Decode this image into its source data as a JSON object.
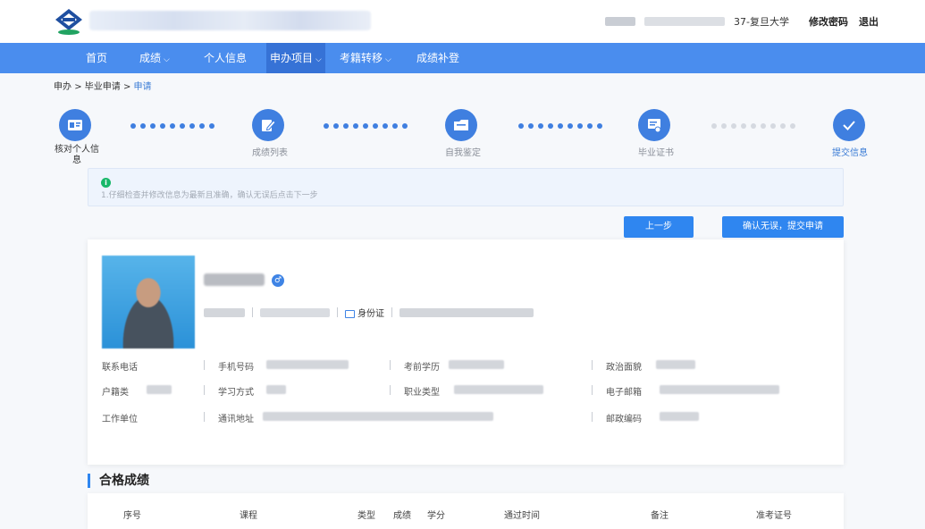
{
  "header": {
    "school_suffix": "37-复旦大学",
    "change_password": "修改密码",
    "logout": "退出"
  },
  "nav": {
    "items": [
      {
        "label": "首页",
        "dropdown": false
      },
      {
        "label": "成绩",
        "dropdown": true
      },
      {
        "label": "个人信息",
        "dropdown": false
      },
      {
        "label": "申办项目",
        "dropdown": true,
        "active": true
      },
      {
        "label": "考籍转移",
        "dropdown": true
      },
      {
        "label": "成绩补登",
        "dropdown": false
      }
    ]
  },
  "breadcrumb": {
    "part1": "申办",
    "part2": "毕业申请",
    "current": "申请",
    "separator": ">"
  },
  "steps": [
    {
      "label": "核对个人信息",
      "icon": "id-card-icon"
    },
    {
      "label": "成绩列表",
      "icon": "edit-icon"
    },
    {
      "label": "自我鉴定",
      "icon": "folder-icon"
    },
    {
      "label": "毕业证书",
      "icon": "certificate-icon"
    },
    {
      "label": "提交信息",
      "icon": "check-icon"
    }
  ],
  "notice": {
    "icon": "i",
    "text": "1.仔细检查并修改信息为最新且准确，确认无误后点击下一步"
  },
  "buttons": {
    "prev": "上一步",
    "submit": "确认无误，提交申请"
  },
  "profile": {
    "gender_symbol": "♂",
    "id_type": "身份证"
  },
  "info_fields": {
    "contact_phone": "联系电话",
    "mobile": "手机号码",
    "prior_education": "考前学历",
    "political_status": "政治面貌",
    "household_type": "户籍类",
    "study_mode": "学习方式",
    "occupation_type": "职业类型",
    "email": "电子邮箱",
    "work_unit": "工作单位",
    "address": "通讯地址",
    "postal_code": "邮政编码"
  },
  "section": {
    "title": "合格成绩"
  },
  "table": {
    "headers": [
      "序号",
      "课程",
      "类型",
      "成绩",
      "学分",
      "通过时间",
      "备注",
      "准考证号"
    ]
  },
  "colors": {
    "primary": "#4a8dee",
    "nav_active": "#3672d6",
    "button": "#2f86f0",
    "success": "#19b86a"
  }
}
